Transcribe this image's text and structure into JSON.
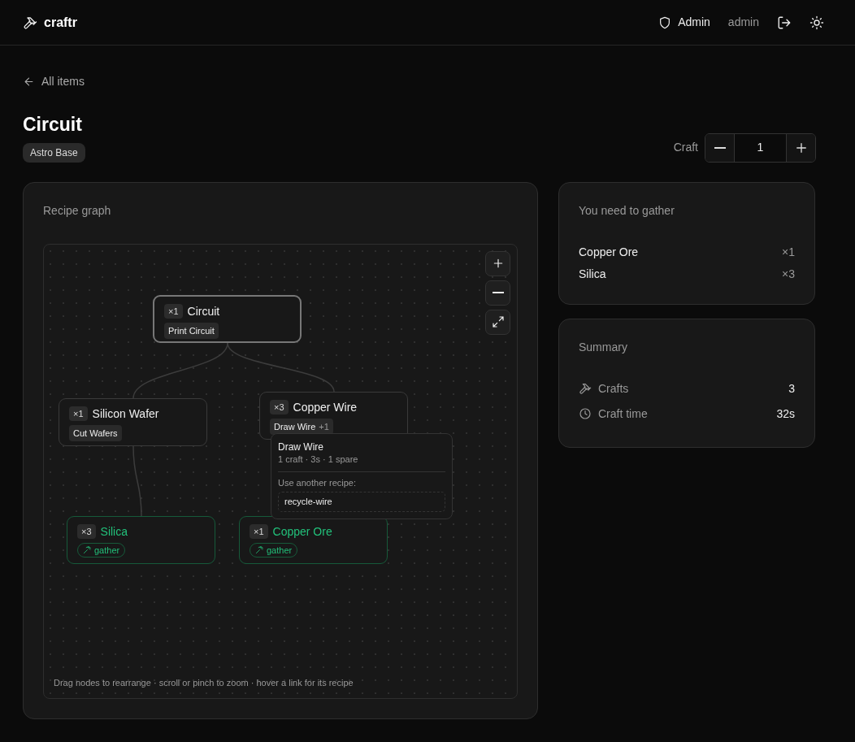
{
  "brand": "craftr",
  "nav": {
    "role": "Admin",
    "user": "admin"
  },
  "back": "All items",
  "item": {
    "title": "Circuit",
    "tag": "Astro Base"
  },
  "craft": {
    "label": "Craft",
    "value": "1"
  },
  "graph": {
    "title": "Recipe graph",
    "hint": "Drag nodes to rearrange · scroll or pinch to zoom · hover a link for its recipe",
    "nodes": [
      {
        "qty": "×1",
        "name": "Circuit",
        "kind": "craft",
        "recipe": "Print Circuit",
        "selected": true,
        "children": [
          {
            "qty": "×1",
            "name": "Silicon Wafer",
            "kind": "craft",
            "recipe": "Cut Wafers",
            "selected": false,
            "children": [
              {
                "qty": "×3",
                "name": "Silica",
                "kind": "gather",
                "recipe": "gather",
                "selected": false
              }
            ]
          },
          {
            "qty": "×3",
            "name": "Copper Wire",
            "kind": "craft",
            "recipe": "Draw Wire",
            "extra": "+1",
            "selected": false,
            "children": [
              {
                "qty": "×1",
                "name": "Copper Ore",
                "kind": "gather",
                "recipe": "gather",
                "selected": false
              }
            ]
          }
        ]
      }
    ],
    "tooltip": {
      "title": "Draw Wire",
      "detail": "1 craft · 3s · 1 spare",
      "alt_label": "Use another recipe:",
      "alternatives": [
        "recycle-wire"
      ]
    }
  },
  "gather": {
    "title": "You need to gather",
    "items": [
      {
        "name": "Copper Ore",
        "qty": "×1"
      },
      {
        "name": "Silica",
        "qty": "×3"
      }
    ]
  },
  "summary": {
    "title": "Summary",
    "rows": [
      {
        "kind": "crafts",
        "label": "Crafts",
        "value": "3"
      },
      {
        "kind": "time",
        "label": "Craft time",
        "value": "32s"
      }
    ]
  }
}
